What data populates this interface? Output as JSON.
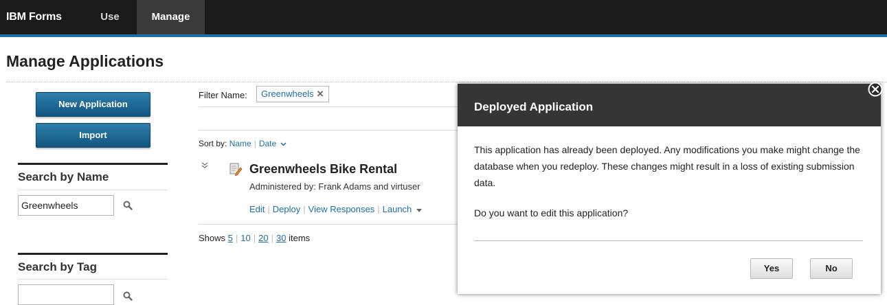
{
  "topbar": {
    "brand": "IBM Forms",
    "nav": [
      {
        "label": "Use"
      },
      {
        "label": "Manage",
        "active": true
      }
    ]
  },
  "page": {
    "title": "Manage Applications"
  },
  "sidebar": {
    "new_application_label": "New Application",
    "import_label": "Import",
    "search_by_name": {
      "title": "Search by Name",
      "value": "Greenwheels",
      "icon": "search-icon"
    },
    "search_by_tag": {
      "title": "Search by Tag",
      "value": "",
      "icon": "search-icon"
    }
  },
  "filter": {
    "label": "Filter Name:",
    "chip_text": "Greenwheels",
    "chip_remove": "✕"
  },
  "sort": {
    "label": "Sort by:",
    "options": [
      "Name",
      "Date"
    ]
  },
  "applications": [
    {
      "name": "Greenwheels Bike Rental",
      "administered_by": "Administered by: Frank Adams and virtuser",
      "actions": [
        "Edit",
        "Deploy",
        "View Responses",
        "Launch"
      ]
    }
  ],
  "paging": {
    "prefix": "Shows",
    "sizes": [
      "5",
      "10",
      "20",
      "30"
    ],
    "suffix": "items"
  },
  "dialog": {
    "title": "Deployed Application",
    "body": "This application has already been deployed. Any modifications you make might change the database when you redeploy. These changes might result in a loss of existing submission data.",
    "question": "Do you want to edit this application?",
    "yes_label": "Yes",
    "no_label": "No"
  },
  "colors": {
    "topbar": "#1a1a1a",
    "accent": "#1d6fa5",
    "dialog_header": "#353535"
  }
}
